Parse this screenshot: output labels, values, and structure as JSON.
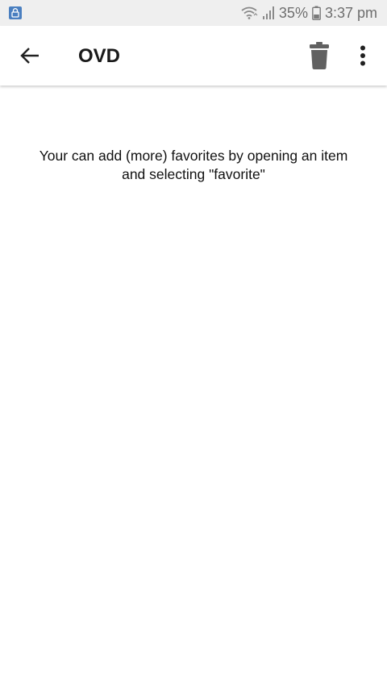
{
  "status_bar": {
    "battery": "35%",
    "time": "3:37 pm",
    "left_icon": "lock-notification-icon",
    "wifi_icon": "wifi-icon",
    "signal_icon": "signal-icon",
    "battery_icon": "battery-icon"
  },
  "app_bar": {
    "title": "OVD",
    "back_icon": "arrow-left-icon",
    "delete_icon": "trash-icon",
    "overflow_icon": "more-vertical-icon"
  },
  "content": {
    "empty_message_line1": "Your can add (more) favorites by opening an item",
    "empty_message_line2": "and selecting \"favorite\""
  },
  "colors": {
    "status_bar_bg": "#efefef",
    "app_bar_bg": "#ffffff",
    "icon_gray": "#616161",
    "text": "#111111"
  }
}
